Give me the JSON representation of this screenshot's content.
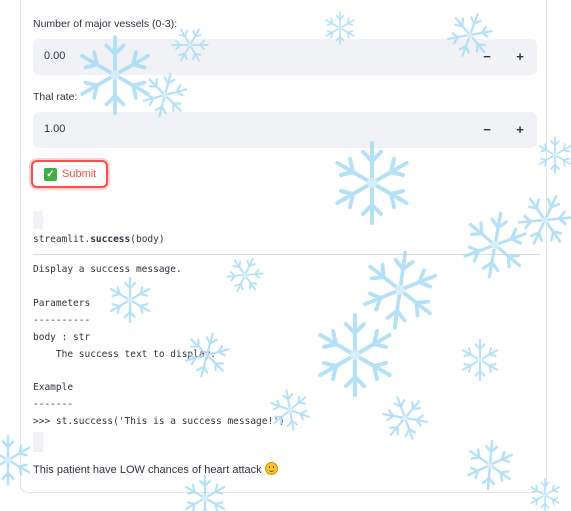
{
  "form": {
    "vessels_label": "Number of major vessels (0-3):",
    "vessels_value": "0.00",
    "thal_label": "Thal rate:",
    "thal_value": "1.00",
    "minus": "−",
    "plus": "+",
    "submit_label": "Submit"
  },
  "docstring": {
    "signature_prefix": "streamlit.",
    "signature_func": "success",
    "signature_args": "(body)",
    "text": "Display a success message.\n\nParameters\n----------\nbody : str\n    The success text to display.\n\nExample\n-------\n>>> st.success('This is a success message!')"
  },
  "result": {
    "text": "This patient have LOW chances of heart attack"
  },
  "decor": {
    "snowflake_color": "#a8dcf7",
    "icon": "snowflake-icon"
  }
}
